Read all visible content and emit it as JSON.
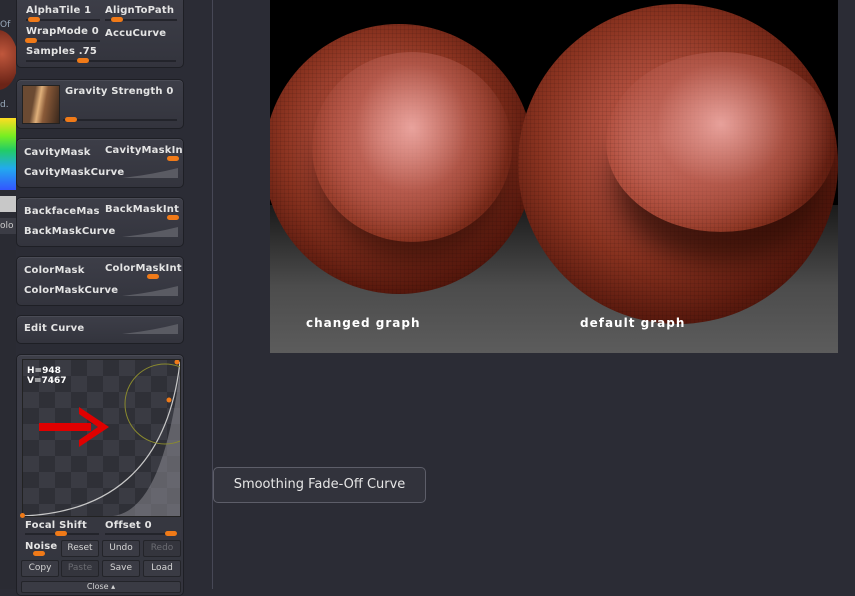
{
  "colors": {
    "accent": "#f07a18",
    "arrow": "#e00000",
    "graph_circle": "#8a8a2e"
  },
  "edge": {
    "label_top": "Of",
    "label_mid": "d.",
    "label_swatch": "olo"
  },
  "sample": {
    "alpha_tile": "AlphaTile 1",
    "align_to_path": "AlignToPath",
    "wrap_mode": "WrapMode 0",
    "accu_curve": "AccuCurve",
    "samples": "Samples .75"
  },
  "gravity": {
    "label": "Gravity Strength 0"
  },
  "cavity": {
    "label": "CavityMask",
    "intensity": "CavityMaskIn",
    "curve": "CavityMaskCurve"
  },
  "backface": {
    "label": "BackfaceMas",
    "intensity": "BackMaskInt",
    "curve": "BackMaskCurve"
  },
  "color": {
    "label": "ColorMask",
    "intensity": "ColorMaskInt",
    "curve": "ColorMaskCurve"
  },
  "edit_curve": {
    "label": "Edit Curve"
  },
  "curve_editor": {
    "h": "H=948",
    "v": "V=7467",
    "focal_shift": "Focal Shift",
    "offset": "Offset 0",
    "noise": "Noise"
  },
  "buttons": {
    "reset": "Reset",
    "undo": "Undo",
    "redo": "Redo",
    "copy": "Copy",
    "paste": "Paste",
    "save": "Save",
    "load": "Load",
    "close": "Close"
  },
  "render": {
    "left_caption": "changed graph",
    "right_caption": "default graph"
  },
  "tooltip": {
    "text": "Smoothing Fade-Off Curve"
  }
}
